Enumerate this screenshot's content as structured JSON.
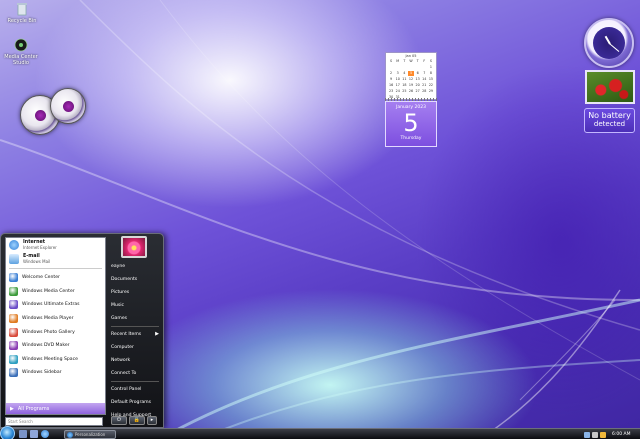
{
  "desktop": {
    "icons": [
      {
        "label": "Recycle Bin",
        "icon": "recycle-bin-icon"
      },
      {
        "label": "Media Center Studio",
        "icon": "media-center-icon"
      }
    ]
  },
  "gadgets": {
    "calendar": {
      "month_header": "Jan  05",
      "weekdays": [
        "S",
        "M",
        "T",
        "W",
        "T",
        "F",
        "S"
      ],
      "days": [
        "",
        "",
        "",
        "",
        "",
        "",
        "1",
        "2",
        "3",
        "4",
        "5",
        "6",
        "7",
        "8",
        "9",
        "10",
        "11",
        "12",
        "13",
        "14",
        "15",
        "16",
        "17",
        "18",
        "19",
        "20",
        "21",
        "22",
        "23",
        "24",
        "25",
        "26",
        "27",
        "28",
        "29",
        "30",
        "31"
      ],
      "today": "5",
      "day_header": "January 2023",
      "day_number": "5",
      "day_name": "Thursday"
    },
    "battery": {
      "line1": "No battery",
      "line2": "detected"
    },
    "clock": {
      "icon": "clock-icon"
    },
    "slideshow": {
      "icon": "slideshow-icon"
    }
  },
  "start_menu": {
    "pinned": [
      {
        "title": "Internet",
        "subtitle": "Internet Explorer",
        "icon": "internet-explorer-icon",
        "color": "#2f7fd6"
      },
      {
        "title": "E-mail",
        "subtitle": "Windows Mail",
        "icon": "mail-icon",
        "color": "#5ea2e0"
      }
    ],
    "recent": [
      {
        "label": "Welcome Center",
        "icon": "welcome-center-icon",
        "color": "#3a7fd5"
      },
      {
        "label": "Windows Media Center",
        "icon": "media-center-icon",
        "color": "#3c9b3a"
      },
      {
        "label": "Windows Ultimate Extras",
        "icon": "ultimate-extras-icon",
        "color": "#6a4cc7"
      },
      {
        "label": "Windows Media Player",
        "icon": "media-player-icon",
        "color": "#e07b21"
      },
      {
        "label": "Windows Photo Gallery",
        "icon": "photo-gallery-icon",
        "color": "#d84a3a"
      },
      {
        "label": "Windows DVD Maker",
        "icon": "dvd-maker-icon",
        "color": "#8a3bb2"
      },
      {
        "label": "Windows Meeting Space",
        "icon": "meeting-space-icon",
        "color": "#2d9fc0"
      },
      {
        "label": "Windows Sidebar",
        "icon": "sidebar-icon",
        "color": "#3b6fb8"
      }
    ],
    "all_programs": "All Programs",
    "search_placeholder": "Start Search",
    "right_items": [
      {
        "label": "eayne",
        "submenu": false
      },
      {
        "label": "Documents",
        "submenu": false
      },
      {
        "label": "Pictures",
        "submenu": false
      },
      {
        "label": "Music",
        "submenu": false
      },
      {
        "label": "Games",
        "submenu": false
      },
      {
        "label": "Recent Items",
        "submenu": true
      },
      {
        "label": "Computer",
        "submenu": false
      },
      {
        "label": "Network",
        "submenu": false
      },
      {
        "label": "Connect To",
        "submenu": false
      },
      {
        "label": "Control Panel",
        "submenu": false
      },
      {
        "label": "Default Programs",
        "submenu": false
      },
      {
        "label": "Help and Support",
        "submenu": false
      }
    ],
    "power_glyph": "⏻",
    "lock_glyph": "🔒",
    "arrow_glyph": "▸",
    "chev_glyph": "▶",
    "all_programs_glyph": "▶"
  },
  "taskbar": {
    "task_label": "Personalization",
    "time": "6:00 AM"
  }
}
